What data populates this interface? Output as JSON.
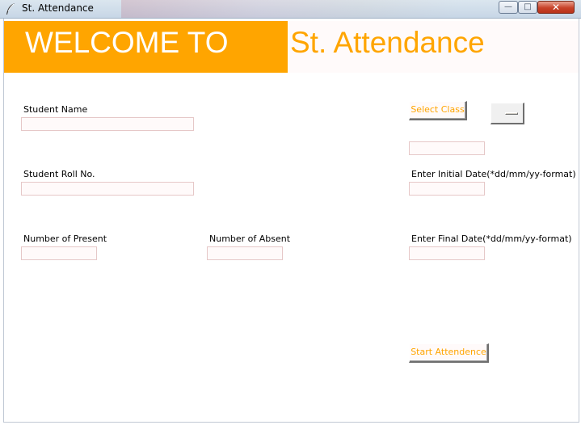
{
  "window": {
    "title": "St. Attendance",
    "minimize_glyph": "—",
    "maximize_glyph": "□",
    "close_glyph": "✕"
  },
  "header": {
    "welcome_text": "WELCOME TO",
    "app_title": "St. Attendance"
  },
  "form": {
    "student_name_label": "Student Name",
    "student_name_value": "",
    "roll_no_label": "Student Roll No.",
    "roll_no_value": "",
    "present_label": "Number of Present",
    "present_value": "",
    "absent_label": "Number of Absent",
    "absent_value": "",
    "select_class_button": "Select Class",
    "class_selected_value": "",
    "class_display_value": "",
    "initial_date_label": "Enter Initial Date(*dd/mm/yy-format)",
    "initial_date_value": "",
    "final_date_label": "Enter Final Date(*dd/mm/yy-format)",
    "final_date_value": "",
    "start_button": "Start Attendence"
  },
  "colors": {
    "accent": "#ffa500",
    "entry_bg": "#fffafa",
    "label_text": "#000000"
  },
  "icons": {
    "window_icon": "feather-icon",
    "optionmenu_indicator": "option-indicator-icon"
  }
}
